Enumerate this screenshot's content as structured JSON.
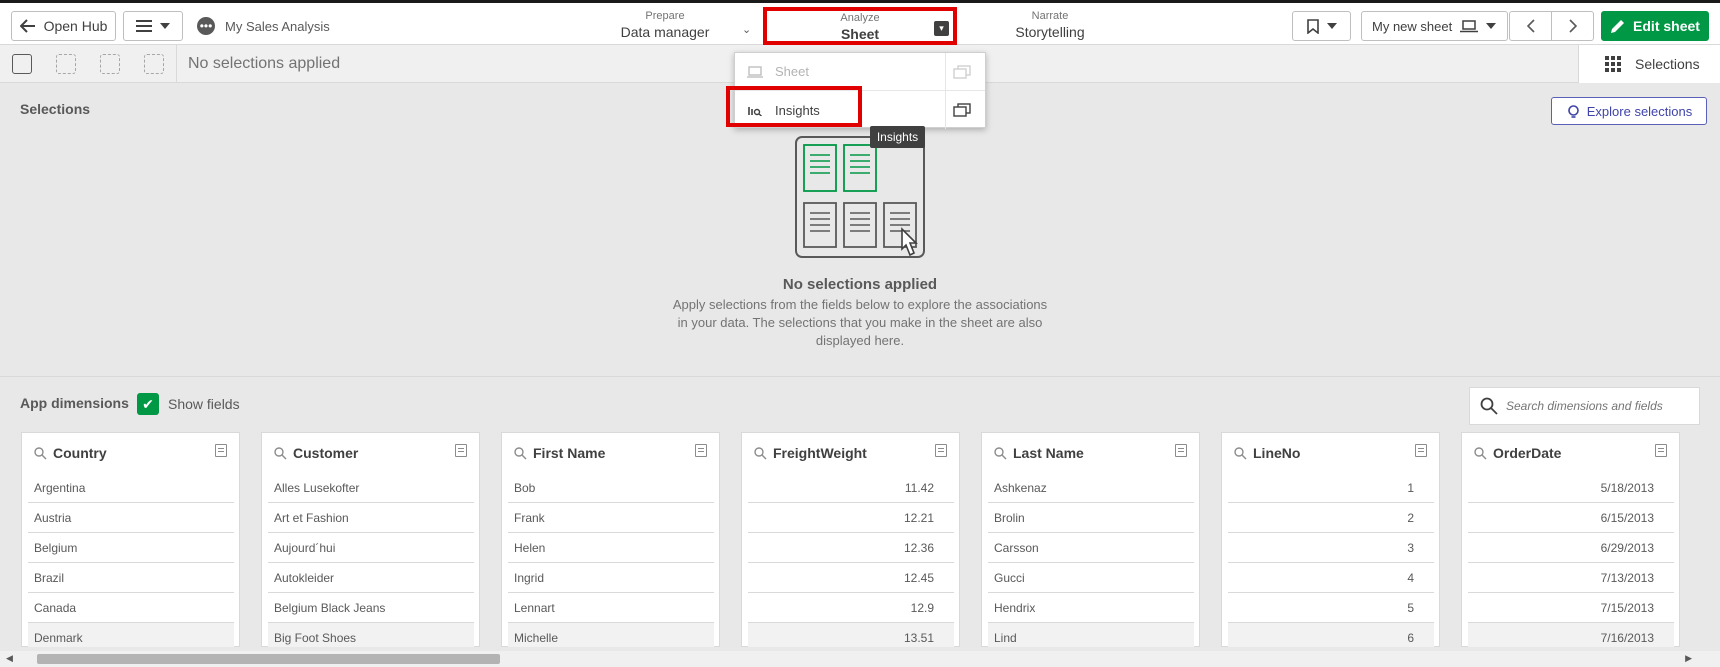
{
  "header": {
    "open_hub": "Open Hub",
    "app_name": "My Sales Analysis",
    "prepare_small": "Prepare",
    "prepare_big": "Data manager",
    "analyze_small": "Analyze",
    "analyze_big": "Sheet",
    "narrate_small": "Narrate",
    "narrate_big": "Storytelling",
    "sheet_name": "My new sheet",
    "edit_sheet": "Edit sheet"
  },
  "toolbar": {
    "no_selections": "No selections applied",
    "selections_tab": "Selections"
  },
  "dropdown": {
    "items": [
      {
        "label": "Sheet",
        "disabled": true
      },
      {
        "label": "Insights",
        "disabled": false
      }
    ],
    "tooltip": "Insights"
  },
  "selections": {
    "heading": "Selections",
    "explore_button": "Explore selections",
    "empty_title": "No selections applied",
    "empty_text": "Apply selections from the fields below to explore the associations in your data. The selections that you make in the sheet are also displayed here."
  },
  "dimensions": {
    "heading": "App dimensions",
    "show_fields": "Show fields",
    "show_fields_checked": true,
    "search_placeholder": "Search dimensions and fields",
    "cards": [
      {
        "title": "Country",
        "numeric": false,
        "values": [
          "Argentina",
          "Austria",
          "Belgium",
          "Brazil",
          "Canada",
          "Denmark"
        ]
      },
      {
        "title": "Customer",
        "numeric": false,
        "values": [
          "Alles Lusekofter",
          "Art et Fashion",
          "Aujourd´hui",
          "Autokleider",
          "Belgium Black Jeans",
          "Big Foot Shoes"
        ]
      },
      {
        "title": "First Name",
        "numeric": false,
        "values": [
          "Bob",
          "Frank",
          "Helen",
          "Ingrid",
          "Lennart",
          "Michelle"
        ]
      },
      {
        "title": "FreightWeight",
        "numeric": true,
        "values": [
          "11.42",
          "12.21",
          "12.36",
          "12.45",
          "12.9",
          "13.51"
        ]
      },
      {
        "title": "Last Name",
        "numeric": false,
        "values": [
          "Ashkenaz",
          "Brolin",
          "Carsson",
          "Gucci",
          "Hendrix",
          "Lind"
        ]
      },
      {
        "title": "LineNo",
        "numeric": true,
        "values": [
          "1",
          "2",
          "3",
          "4",
          "5",
          "6"
        ]
      },
      {
        "title": "OrderDate",
        "numeric": true,
        "values": [
          "5/18/2013",
          "6/15/2013",
          "6/29/2013",
          "7/13/2013",
          "7/15/2013",
          "7/16/2013"
        ]
      }
    ]
  },
  "colors": {
    "accent_green": "#009845",
    "highlight_red": "#e00000",
    "explore_purple": "#3f44a8"
  }
}
